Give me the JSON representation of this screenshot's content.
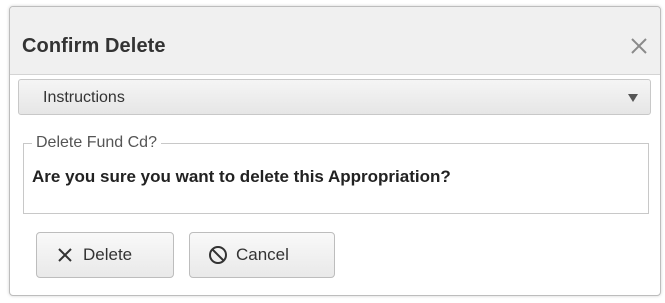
{
  "dialog": {
    "title": "Confirm Delete",
    "close_icon": "close-icon"
  },
  "instructions": {
    "label": "Instructions",
    "caret_icon": "caret-down-icon"
  },
  "fieldset": {
    "legend": "Delete Fund Cd?",
    "message": "Are you sure you want to delete this Appropriation?"
  },
  "buttons": {
    "delete_label": "Delete",
    "delete_icon": "x-icon",
    "cancel_label": "Cancel",
    "cancel_icon": "ban-icon"
  }
}
